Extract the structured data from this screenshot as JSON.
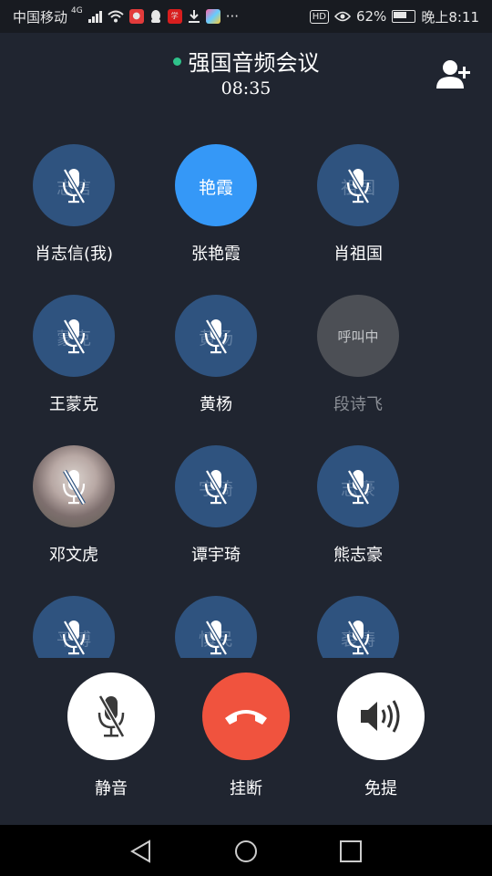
{
  "status_bar": {
    "carrier": "中国移动",
    "network": "4G",
    "hd_label": "HD",
    "battery_percent": "62%",
    "time": "晚上8:11"
  },
  "header": {
    "title": "强国音频会议",
    "timer": "08:35",
    "status_color": "#2fc28a"
  },
  "participants": [
    {
      "name": "肖志信(我)",
      "avatar_text": "志信",
      "state": "muted"
    },
    {
      "name": "张艳霞",
      "avatar_text": "艳霞",
      "state": "speaking"
    },
    {
      "name": "肖祖国",
      "avatar_text": "祖国",
      "state": "muted"
    },
    {
      "name": "王蒙克",
      "avatar_text": "蒙克",
      "state": "muted"
    },
    {
      "name": "黄杨",
      "avatar_text": "黄杨",
      "state": "muted"
    },
    {
      "name": "段诗飞",
      "avatar_text": "呼叫中",
      "state": "calling"
    },
    {
      "name": "邓文虎",
      "avatar_text": "",
      "state": "muted-photo"
    },
    {
      "name": "谭宇琦",
      "avatar_text": "宇琦",
      "state": "muted"
    },
    {
      "name": "熊志豪",
      "avatar_text": "志豪",
      "state": "muted"
    },
    {
      "name": "",
      "avatar_text": "平博",
      "state": "muted"
    },
    {
      "name": "",
      "avatar_text": "慎民",
      "state": "muted"
    },
    {
      "name": "",
      "avatar_text": "裘涛",
      "state": "muted"
    }
  ],
  "controls": {
    "mute_label": "静音",
    "hangup_label": "挂断",
    "speaker_label": "免提"
  },
  "colors": {
    "background": "#202530",
    "avatar": "#2f537f",
    "active_avatar": "#3598f7",
    "hangup": "#f0533e"
  }
}
